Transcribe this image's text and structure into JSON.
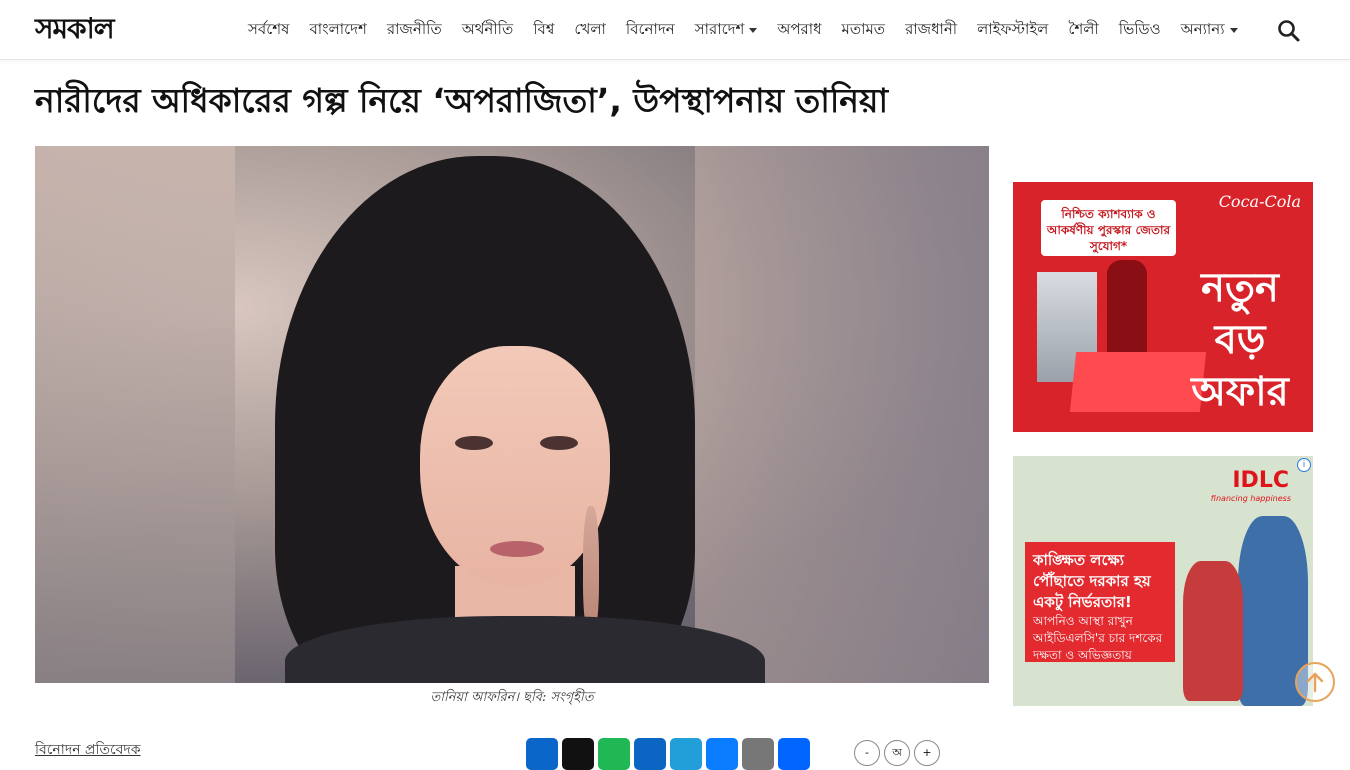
{
  "header": {
    "logo_text": "সমকাল",
    "nav": [
      {
        "label": "সর্বশেষ",
        "dropdown": false
      },
      {
        "label": "বাংলাদেশ",
        "dropdown": false
      },
      {
        "label": "রাজনীতি",
        "dropdown": false
      },
      {
        "label": "অর্থনীতি",
        "dropdown": false
      },
      {
        "label": "বিশ্ব",
        "dropdown": false
      },
      {
        "label": "খেলা",
        "dropdown": false
      },
      {
        "label": "বিনোদন",
        "dropdown": false
      },
      {
        "label": "সারাদেশ",
        "dropdown": true
      },
      {
        "label": "অপরাধ",
        "dropdown": false
      },
      {
        "label": "মতামত",
        "dropdown": false
      },
      {
        "label": "রাজধানী",
        "dropdown": false
      },
      {
        "label": "লাইফস্টাইল",
        "dropdown": false
      },
      {
        "label": "শৈলী",
        "dropdown": false
      },
      {
        "label": "ভিডিও",
        "dropdown": false
      },
      {
        "label": "অন্যান্য",
        "dropdown": true
      }
    ],
    "search_icon": "search-icon"
  },
  "article": {
    "headline": "নারীদের অধিকারের গল্প নিয়ে ‘অপরাজিতা’, উপস্থাপনায় তানিয়া",
    "image_caption": "তানিয়া আফরিন। ছবি: সংগৃহীত",
    "byline": "বিনোদন প্রতিবেদক"
  },
  "share": {
    "buttons": [
      "Facebook",
      "X",
      "WhatsApp",
      "LinkedIn",
      "Telegram",
      "Messenger",
      "Email",
      "Share"
    ],
    "font_controls": [
      "-",
      "অ",
      "+"
    ]
  },
  "ads": {
    "ad1": {
      "tag": "নিশ্চিত ক্যাশব্যাক ও আকর্ষণীয় পুরস্কার জেতার সুযোগ*",
      "brand": "Coca-Cola",
      "offer": "নতুন বড় অফার"
    },
    "ad2": {
      "brand": "IDLC",
      "tagline": "financing happiness",
      "headline": "কাঙ্ক্ষিত লক্ষ্যে পৌঁছাতে দরকার হয় একটু নির্ভরতার!",
      "body": "আপনিও আস্থা রাখুন আইডিএলসি'র চার দশকের দক্ষতা ও অভিজ্ঞতায়",
      "info_icon": "i"
    }
  },
  "colors": {
    "accent_orange": "#e8a25a",
    "coke_red": "#d8232a",
    "idlc_red": "#e0121a"
  }
}
